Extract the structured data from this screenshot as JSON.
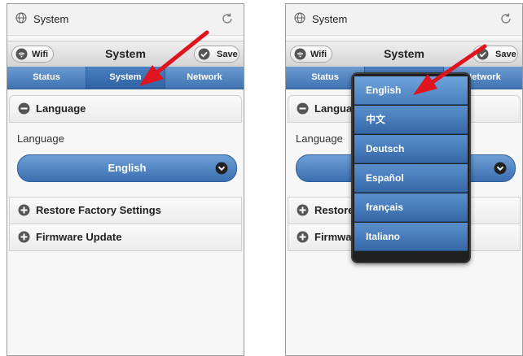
{
  "left": {
    "browser_title": "System",
    "header": {
      "wifi": "Wifi",
      "title": "System",
      "save": "Save"
    },
    "tabs": [
      "Status",
      "System",
      "Network"
    ],
    "language_section": "Language",
    "language_label": "Language",
    "language_value": "English",
    "restore_section": "Restore Factory Settings",
    "firmware_section": "Firmware Update"
  },
  "right": {
    "browser_title": "System",
    "header": {
      "wifi": "Wifi",
      "title": "System",
      "save": "Save"
    },
    "tabs": [
      "Status",
      "System",
      "Network"
    ],
    "language_section": "Langua",
    "language_label": "Language",
    "restore_section": "Restore",
    "firmware_section": "Firmwa",
    "dropdown_options": [
      "English",
      "中文",
      "Deutsch",
      "Español",
      "français",
      "Italiano"
    ],
    "selected_option": "English"
  },
  "icons": {
    "globe": "globe-icon",
    "reload": "reload-icon",
    "wifi": "wifi-icon",
    "save": "check-icon",
    "expanded": "minus-icon",
    "collapsed": "plus-icon",
    "chevron": "chevron-down-icon",
    "annotation": "red-arrow"
  },
  "colors": {
    "accent": "#3f73b3",
    "arrow": "#e0141e"
  }
}
